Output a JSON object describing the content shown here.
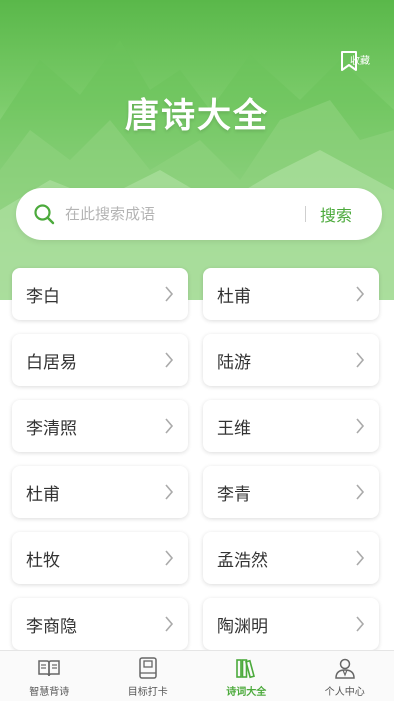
{
  "header": {
    "title": "唐诗大全",
    "bookmark_label": "收藏"
  },
  "search": {
    "placeholder": "在此搜索成语",
    "button_label": "搜索"
  },
  "poets": [
    {
      "name": "李白"
    },
    {
      "name": "杜甫"
    },
    {
      "name": "白居易"
    },
    {
      "name": "陆游"
    },
    {
      "name": "李清照"
    },
    {
      "name": "王维"
    },
    {
      "name": "杜甫"
    },
    {
      "name": "李青"
    },
    {
      "name": "杜牧"
    },
    {
      "name": "孟浩然"
    },
    {
      "name": "李商隐"
    },
    {
      "name": "陶渊明"
    }
  ],
  "tabs": [
    {
      "label": "智慧背诗",
      "icon": "book-open-icon"
    },
    {
      "label": "目标打卡",
      "icon": "notebook-icon"
    },
    {
      "label": "诗词大全",
      "icon": "books-icon",
      "active": true
    },
    {
      "label": "个人中心",
      "icon": "user-icon"
    }
  ],
  "colors": {
    "accent": "#4caa3c",
    "hero_top": "#5ab84a"
  }
}
